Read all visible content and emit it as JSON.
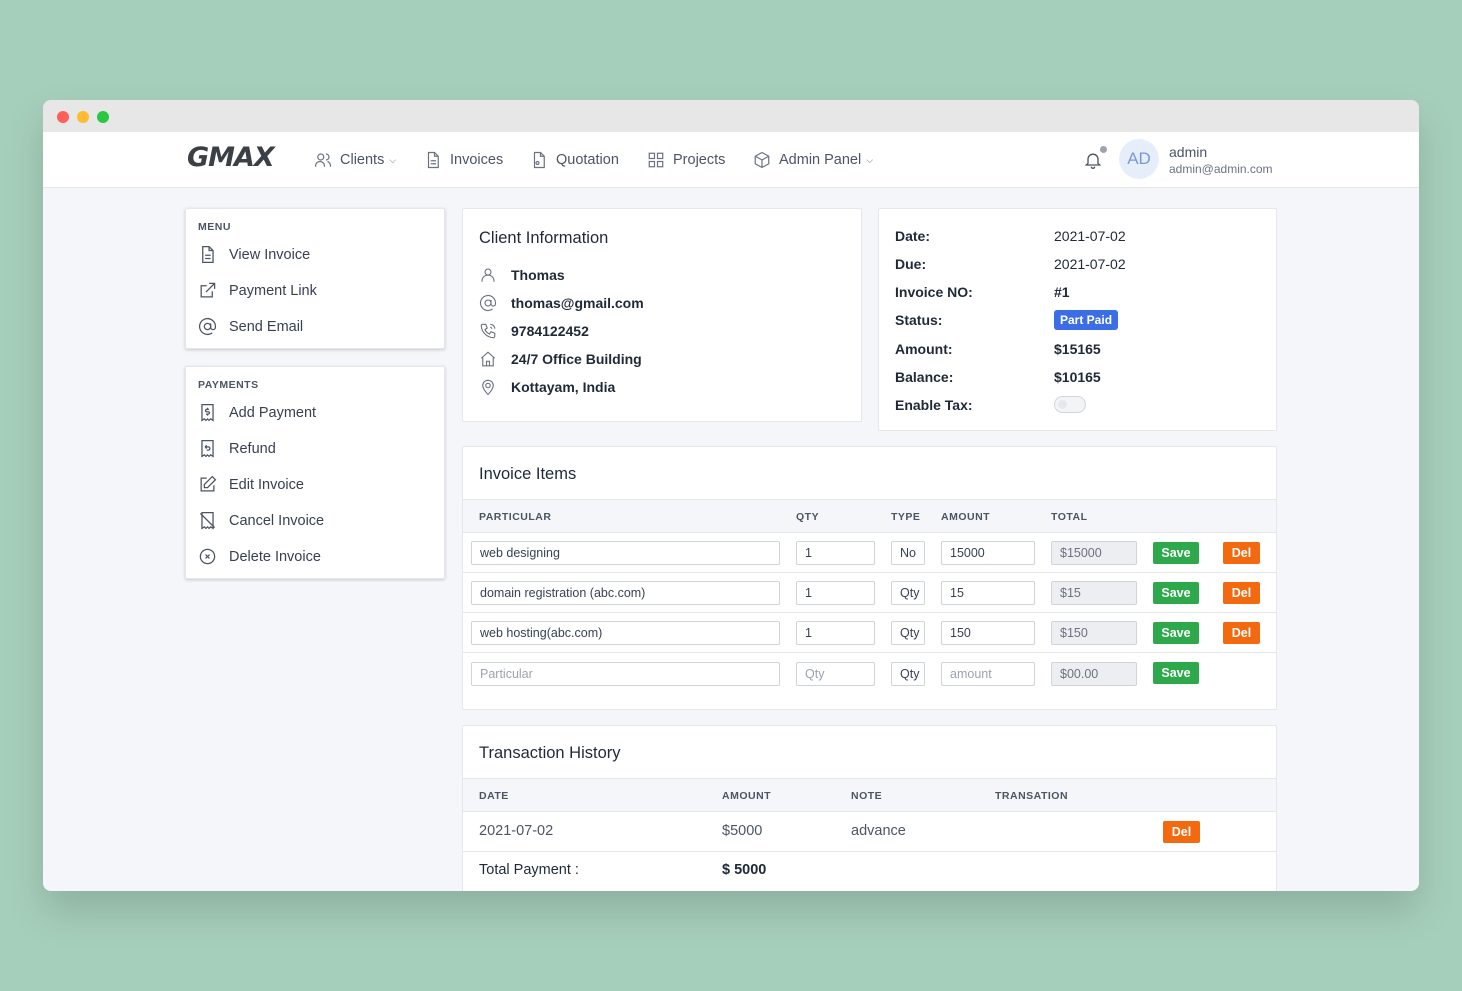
{
  "brand": {
    "logo": "GMAX"
  },
  "nav": [
    {
      "label": "Clients",
      "dropdown": true,
      "icon": "users-icon"
    },
    {
      "label": "Invoices",
      "dropdown": false,
      "icon": "document-icon"
    },
    {
      "label": "Quotation",
      "dropdown": false,
      "icon": "quote-document-icon"
    },
    {
      "label": "Projects",
      "dropdown": false,
      "icon": "grid-icon"
    },
    {
      "label": "Admin Panel",
      "dropdown": true,
      "icon": "box-icon"
    }
  ],
  "user": {
    "initials": "AD",
    "name": "admin",
    "email": "admin@admin.com"
  },
  "menu": {
    "heading": "MENU",
    "items": [
      {
        "label": "View Invoice",
        "icon": "document-icon"
      },
      {
        "label": "Payment Link",
        "icon": "external-link-icon"
      },
      {
        "label": "Send Email",
        "icon": "at-sign-icon"
      }
    ]
  },
  "payments_menu": {
    "heading": "PAYMENTS",
    "items": [
      {
        "label": "Add Payment",
        "icon": "dollar-receipt-icon"
      },
      {
        "label": "Refund",
        "icon": "refund-receipt-icon"
      },
      {
        "label": "Edit Invoice",
        "icon": "edit-icon"
      },
      {
        "label": "Cancel Invoice",
        "icon": "cancel-receipt-icon"
      },
      {
        "label": "Delete Invoice",
        "icon": "x-circle-icon"
      }
    ]
  },
  "client": {
    "title": "Client Information",
    "name": "Thomas",
    "email": "thomas@gmail.com",
    "phone": "9784122452",
    "address": "24/7 Office Building",
    "location": "Kottayam, India"
  },
  "invoice_info": {
    "date_label": "Date:",
    "date": "2021-07-02",
    "due_label": "Due:",
    "due": "2021-07-02",
    "no_label": "Invoice NO:",
    "no": "#1",
    "status_label": "Status:",
    "status": "Part Paid",
    "status_color": "#3b6ee6",
    "amount_label": "Amount:",
    "amount": "$15165",
    "balance_label": "Balance:",
    "balance": "$10165",
    "tax_label": "Enable Tax:",
    "tax_enabled": false
  },
  "items": {
    "title": "Invoice Items",
    "headers": {
      "particular": "PARTICULAR",
      "qty": "QTY",
      "type": "TYPE",
      "amount": "AMOUNT",
      "total": "TOTAL"
    },
    "rows": [
      {
        "particular": "web designing",
        "qty": "1",
        "type": "No",
        "amount": "15000",
        "total": "$15000",
        "save": "Save",
        "del": "Del"
      },
      {
        "particular": "domain registration (abc.com)",
        "qty": "1",
        "type": "Qty",
        "amount": "15",
        "total": "$15",
        "save": "Save",
        "del": "Del"
      },
      {
        "particular": "web hosting(abc.com)",
        "qty": "1",
        "type": "Qty",
        "amount": "150",
        "total": "$150",
        "save": "Save",
        "del": "Del"
      }
    ],
    "new_row": {
      "particular_ph": "Particular",
      "qty_ph": "Qty",
      "type": "Qty",
      "amount_ph": "amount",
      "total": "$00.00",
      "save": "Save"
    }
  },
  "transactions": {
    "title": "Transaction History",
    "headers": {
      "date": "DATE",
      "amount": "AMOUNT",
      "note": "NOTE",
      "transation": "TRANSATION"
    },
    "rows": [
      {
        "date": "2021-07-02",
        "amount": "$5000",
        "note": "advance",
        "del": "Del"
      }
    ],
    "total_label": "Total Payment :",
    "total_value": "$ 5000"
  },
  "colors": {
    "save": "#2da84a",
    "del": "#f2690f",
    "background": "#a6cfbb"
  }
}
